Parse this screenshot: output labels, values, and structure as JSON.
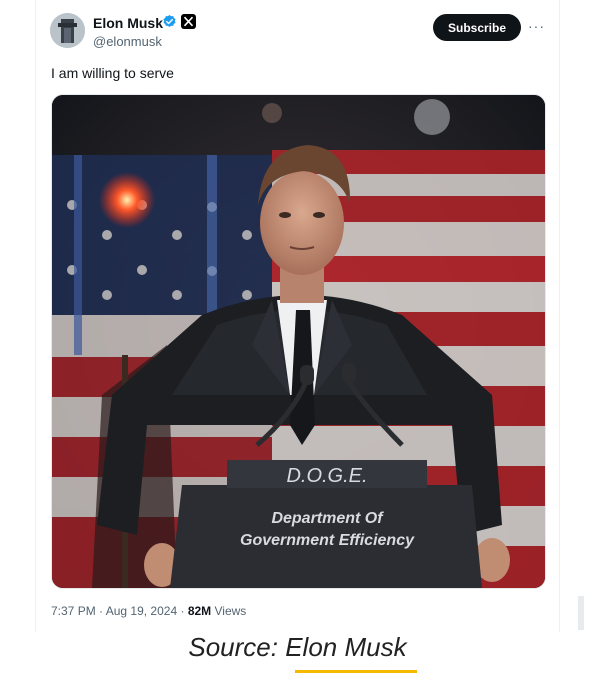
{
  "author": {
    "name": "Elon Musk",
    "handle": "@elonmusk",
    "verified_icon": "verified-badge-icon",
    "affiliate_icon": "x-logo-icon"
  },
  "actions": {
    "subscribe_label": "Subscribe",
    "more_label": "···"
  },
  "tweet": {
    "text": "I am willing to serve",
    "image_text": {
      "podium_top": "D.O.G.E.",
      "podium_line1": "Department Of",
      "podium_line2": "Government Efficiency"
    },
    "time": "7:37 PM",
    "separator": "·",
    "date": "Aug 19, 2024",
    "views_count": "82M",
    "views_label": "Views"
  },
  "caption": {
    "prefix": "Source:",
    "name": "Elon Musk"
  },
  "colors": {
    "brand_black": "#0f1419",
    "verified_blue": "#1d9bf0",
    "secondary_text": "#536471",
    "accent_underline": "#f5b800"
  }
}
